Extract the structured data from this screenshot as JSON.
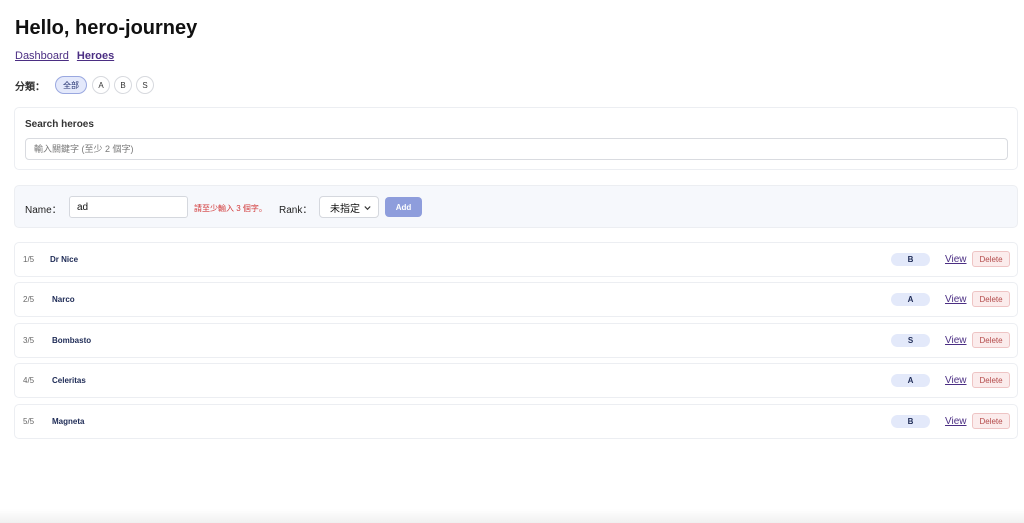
{
  "header": {
    "title": "Hello, hero-journey"
  },
  "nav": {
    "items": [
      {
        "label": "Dashboard",
        "active": false
      },
      {
        "label": "Heroes",
        "active": true
      }
    ]
  },
  "filter": {
    "label": "分類：",
    "chips": [
      {
        "label": "全部",
        "selected": true
      },
      {
        "label": "A",
        "selected": false
      },
      {
        "label": "B",
        "selected": false
      },
      {
        "label": "S",
        "selected": false
      }
    ]
  },
  "search": {
    "label": "Search heroes",
    "placeholder": "輸入關鍵字 (至少 2 個字)"
  },
  "add_form": {
    "name_label": "Name：",
    "name_value": "ad",
    "error": "請至少輸入 3 個字。",
    "rank_label": "Rank：",
    "rank_selected": "未指定",
    "add_label": "Add"
  },
  "heroes": [
    {
      "index": "1/5",
      "name": "Dr Nice",
      "rank": "B",
      "view_label": "View",
      "delete_label": "Delete"
    },
    {
      "index": "2/5",
      "name": "Narco",
      "rank": "A",
      "view_label": "View",
      "delete_label": "Delete"
    },
    {
      "index": "3/5",
      "name": "Bombasto",
      "rank": "S",
      "view_label": "View",
      "delete_label": "Delete"
    },
    {
      "index": "4/5",
      "name": "Celeritas",
      "rank": "A",
      "view_label": "View",
      "delete_label": "Delete"
    },
    {
      "index": "5/5",
      "name": "Magneta",
      "rank": "B",
      "view_label": "View",
      "delete_label": "Delete"
    }
  ],
  "colors": {
    "link": "#4b2e83",
    "accent_button": "#8e9ddc",
    "badge_bg": "#e3e9fa",
    "error": "#d23a3a",
    "delete_bg": "#fbecec"
  },
  "icons": {
    "rank_select": "chevron-down-icon"
  }
}
